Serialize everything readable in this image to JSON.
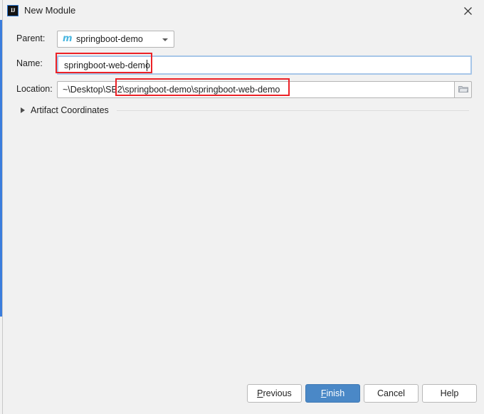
{
  "window": {
    "title": "New Module",
    "app_icon": "intellij-idea-icon",
    "app_icon_text": "IJ",
    "close_icon": "close-icon"
  },
  "form": {
    "parent": {
      "label": "Parent:",
      "value": "springboot-demo",
      "icon": "maven-module-icon",
      "icon_text": "m",
      "dropdown_icon": "chevron-down-icon"
    },
    "name": {
      "label": "Name:",
      "value": "springboot-web-demo",
      "focused": true
    },
    "location": {
      "label": "Location:",
      "value": "~\\Desktop\\SB2\\springboot-demo\\springboot-web-demo",
      "browse_icon": "folder-icon"
    },
    "artifact": {
      "label": "Artifact Coordinates",
      "expander_icon": "chevron-right-icon",
      "expanded": false
    }
  },
  "annotations": {
    "color": "#ec2227",
    "boxes": [
      {
        "name": "name-field-highlight"
      },
      {
        "name": "location-path-highlight"
      }
    ]
  },
  "footer": {
    "buttons": [
      {
        "name": "previous",
        "prefix": "P",
        "rest": "revious",
        "primary": false
      },
      {
        "name": "finish",
        "prefix": "F",
        "rest": "inish",
        "primary": true
      },
      {
        "name": "cancel",
        "prefix": "",
        "rest": "Cancel",
        "primary": false
      },
      {
        "name": "help",
        "prefix": "",
        "rest": "Help",
        "primary": false
      }
    ]
  },
  "colors": {
    "dialog_bg": "#f1f1f1",
    "primary_button": "#4a88c7",
    "focus_border": "#a7c6e8",
    "annotation_red": "#ec2227",
    "maven_icon": "#49b6e0",
    "window_edge_blue": "#3b7ddd"
  }
}
